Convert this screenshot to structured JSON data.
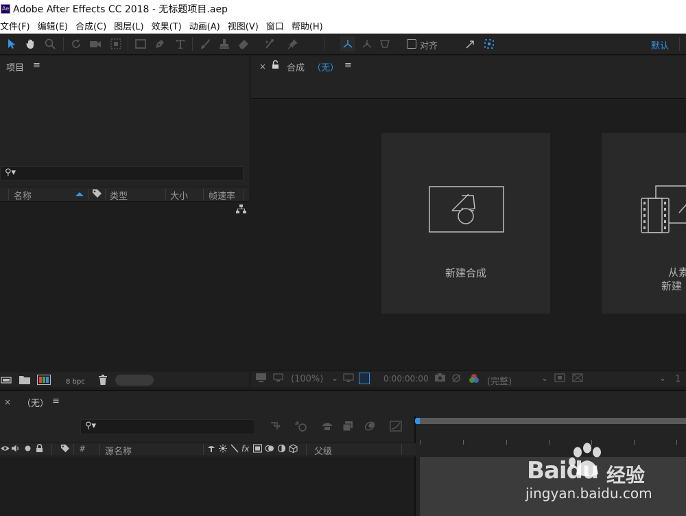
{
  "window": {
    "title": "Adobe After Effects CC 2018 - 无标题项目.aep",
    "logo_text": "Ae"
  },
  "menubar": {
    "items": [
      "文件(F)",
      "编辑(E)",
      "合成(C)",
      "图层(L)",
      "效果(T)",
      "动画(A)",
      "视图(V)",
      "窗口",
      "帮助(H)"
    ]
  },
  "toolbar": {
    "tools": [
      "selection-tool",
      "hand-tool",
      "zoom-tool",
      "rotate-tool",
      "camera-tool",
      "pan-behind-tool",
      "rectangle-tool",
      "pen-tool",
      "type-tool",
      "brush-tool",
      "clone-stamp-tool",
      "eraser-tool",
      "roto-brush-tool",
      "puppet-pin-tool"
    ],
    "snap_label": "对齐",
    "workspace_label": "默认",
    "accent_color": "#2f95e8"
  },
  "project_panel": {
    "title": "项目",
    "menu_glyph": "≡",
    "search_glyph": "⚲▾",
    "columns": [
      "名称",
      "类型",
      "大小",
      "帧速率"
    ],
    "bpc_label": "8 bpc"
  },
  "composition_panel": {
    "close_glyph": "×",
    "tab_label": "合成",
    "tab_comp_name": "（无）",
    "menu_glyph": "≡",
    "cards": [
      {
        "label": "新建合成"
      },
      {
        "label_line1": "从素",
        "label_line2": "新建"
      }
    ],
    "footer": {
      "zoom": "(100%)",
      "timecode": "0:00:00:00",
      "resolution": "(完整)",
      "extra": "1"
    }
  },
  "timeline_panel": {
    "close_glyph": "×",
    "title": "（无）",
    "menu_glyph": "≡",
    "search_glyph": "⚲▾",
    "columns": {
      "hash": "#",
      "source_name": "源名称",
      "fx": "fx",
      "parent": "父级"
    },
    "switch_symbols": [
      "👁",
      "🔊",
      "●",
      "🔒"
    ]
  },
  "watermark": {
    "brand": "Baidu",
    "brand_cn": "经验",
    "url": "jingyan.baidu.com"
  }
}
